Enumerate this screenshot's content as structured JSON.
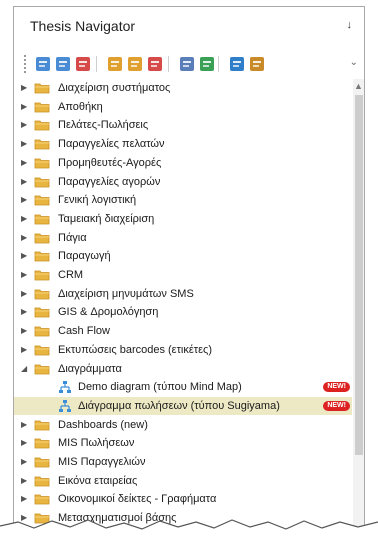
{
  "panel": {
    "title": "Thesis Navigator",
    "pin_glyph": "↓"
  },
  "toolbar": {
    "buttons": [
      "add-doc-icon",
      "list-doc-icon",
      "delete-doc-icon",
      "add-folder-icon",
      "edit-folder-icon",
      "delete-folder-icon",
      "properties-icon",
      "chart-icon",
      "refresh-icon",
      "layout-dropdown-icon"
    ],
    "more_glyph": "⌄"
  },
  "tree": {
    "items": [
      {
        "label": "Διαχείριση συστήματος",
        "expanded": false
      },
      {
        "label": "Αποθήκη",
        "expanded": false
      },
      {
        "label": "Πελάτες-Πωλήσεις",
        "expanded": false
      },
      {
        "label": "Παραγγελίες πελατών",
        "expanded": false
      },
      {
        "label": "Προμηθευτές-Αγορές",
        "expanded": false
      },
      {
        "label": "Παραγγελίες αγορών",
        "expanded": false
      },
      {
        "label": "Γενική λογιστική",
        "expanded": false
      },
      {
        "label": "Ταμειακή διαχείριση",
        "expanded": false
      },
      {
        "label": "Πάγια",
        "expanded": false
      },
      {
        "label": "Παραγωγή",
        "expanded": false
      },
      {
        "label": "CRM",
        "expanded": false
      },
      {
        "label": "Διαχείριση μηνυμάτων SMS",
        "expanded": false
      },
      {
        "label": "GIS & Δρομολόγηση",
        "expanded": false
      },
      {
        "label": "Cash Flow",
        "expanded": false
      },
      {
        "label": "Εκτυπώσεις barcodes (ετικέτες)",
        "expanded": false
      },
      {
        "label": "Διαγράμματα",
        "expanded": true
      },
      {
        "label": "Demo diagram (τύπου Mind Map)",
        "child": true,
        "badge": "NEW!"
      },
      {
        "label": "Διάγραμμα πωλήσεων (τύπου Sugiyama)",
        "child": true,
        "badge": "NEW!",
        "selected": true
      },
      {
        "label": "Dashboards (new)",
        "expanded": false
      },
      {
        "label": "MIS Πωλήσεων",
        "expanded": false
      },
      {
        "label": "MIS Παραγγελιών",
        "expanded": false
      },
      {
        "label": "Εικόνα εταιρείας",
        "expanded": false
      },
      {
        "label": "Οικονομικοί δείκτες - Γραφήματα",
        "expanded": false
      },
      {
        "label": "Μετασχηματισμοί βάσης",
        "expanded": false
      }
    ]
  },
  "colors": {
    "folder": "#e8b540",
    "folder_dark": "#c9901f",
    "badge": "#d22222",
    "selected": "#ece9c4",
    "diagram": "#3b8fd9"
  }
}
